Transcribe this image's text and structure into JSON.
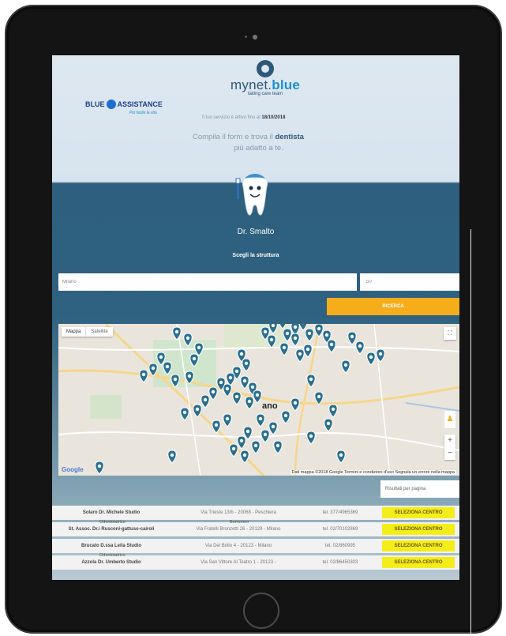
{
  "header": {
    "brand_main": "mynet.",
    "brand_accent": "blue",
    "brand_tagline": "taking care team",
    "partner_logo_left": "BLUE",
    "partner_logo_right": "ASSISTANCE",
    "partner_tagline": "Più facile la vita",
    "service_prefix": "Il tuo servizio è attivo fino al",
    "service_date": "18/10/2018",
    "intro_prefix": "Compila il form e trova il",
    "intro_highlight": "dentista",
    "intro_suffix": "più adatto a te."
  },
  "mascot": {
    "name": "Dr. Smalto"
  },
  "search": {
    "section_title": "Scegli la struttura",
    "city_value": "Milano",
    "radius_value": "50",
    "button_label": "RICERCA"
  },
  "map": {
    "type_map": "Mappa",
    "type_satellite": "Satellite",
    "city_label": "ano",
    "google": "Google",
    "footer": "Dati mappa ©2018 Google   Termini e condizioni d'uso   Segnala un errore nella mappa",
    "marker_count": 66
  },
  "results_per_page": "Risultati per pagina",
  "results": [
    {
      "name": "Solaro Dr. Michele Studio",
      "address": "Via Trieste 13/b - 20068 - Peschiera",
      "phone": "tel. 377/4965369",
      "action": "SELEZIONA CENTRO",
      "overlay_top": ""
    },
    {
      "name": "St. Assoc. Dr.i Rusconi-gattuso-cairoli",
      "address": "Via Fratelli Bronzetti 26 - 20129 - Milano",
      "phone": "tel. 02/70102869",
      "action": "SELEZIONA CENTRO",
      "overlay_top": "Odontoiatrico",
      "overlay_addr": "Borromeo"
    },
    {
      "name": "Brucato D.ssa Leila Studio",
      "address": "Via Del Bollo 4 - 20123 - Milano",
      "phone": "tel. 02/860995",
      "action": "SELEZIONA CENTRO",
      "overlay_top": ""
    },
    {
      "name": "Azzola Dr. Umberto Studio",
      "address": "Via San Vittore Al Teatro 1 - 20123 -",
      "phone": "tel. 02/86450303",
      "action": "SELEZIONA CENTRO",
      "overlay_top": "Odontoiatrico"
    }
  ],
  "colors": {
    "brand_dark": "#2f5876",
    "brand_blue": "#1d8fd2",
    "search_button": "#f6ad1c",
    "select_button": "#f5ed1a",
    "marker": "#2a6f8f"
  }
}
